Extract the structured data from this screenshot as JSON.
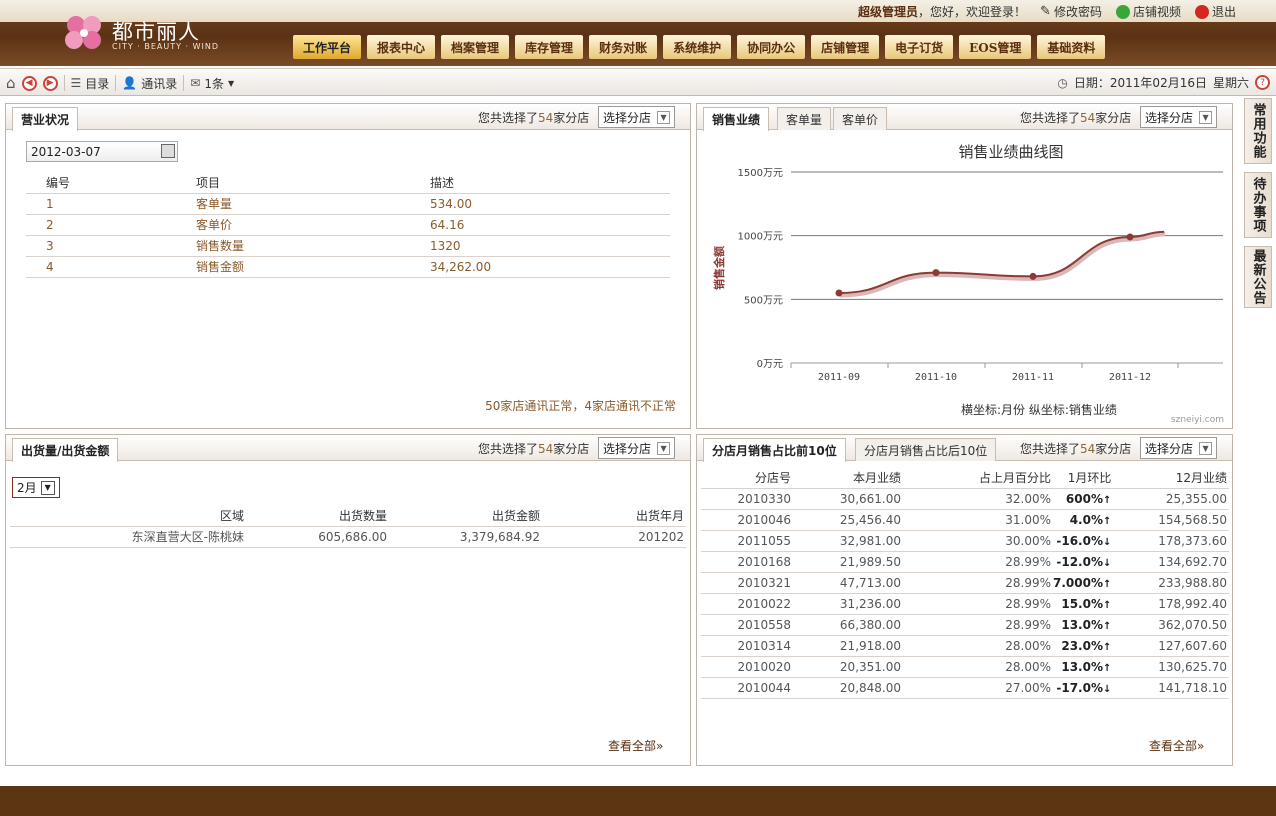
{
  "header": {
    "logo_cn": "都市丽人",
    "logo_en": "CITY · BEAUTY · WIND",
    "user_role": "超级管理员",
    "greeting": "，您好，欢迎登录！",
    "change_password": "修改密码",
    "store_video": "店铺视频",
    "logout": "退出",
    "nav": [
      "工作平台",
      "报表中心",
      "档案管理",
      "库存管理",
      "财务对账",
      "系统维护",
      "协同办公",
      "店铺管理",
      "电子订货",
      "EOS管理",
      "基础资料"
    ]
  },
  "toolbar": {
    "catalog": "目录",
    "contacts": "通讯录",
    "messages": "1条",
    "date_label": "日期：",
    "date_value": "2011年02月16日",
    "weekday": "星期六"
  },
  "panel_business": {
    "tab": "营业状况",
    "selected_prefix": "您共选择了",
    "selected_count": "54",
    "selected_suffix": "家分店",
    "select_button": "选择分店",
    "date": "2012-03-07",
    "columns": [
      "编号",
      "项目",
      "描述"
    ],
    "rows": [
      [
        "1",
        "客单量",
        "534.00"
      ],
      [
        "2",
        "客单价",
        "64.16"
      ],
      [
        "3",
        "销售数量",
        "1320"
      ],
      [
        "4",
        "销售金额",
        "34,262.00"
      ]
    ],
    "note": "50家店通讯正常，4家店通讯不正常"
  },
  "panel_sales": {
    "tabs": [
      "销售业绩",
      "客单量",
      "客单价"
    ],
    "selected_prefix": "您共选择了",
    "selected_count": "54",
    "selected_suffix": "家分店",
    "select_button": "选择分店",
    "axis_caption": "横坐标:月份 纵坐标:销售业绩",
    "watermark": "szneiyi.com"
  },
  "chart_data": {
    "type": "line",
    "title": "销售业绩曲线图",
    "ylabel": "销售金额",
    "categories": [
      "2011-09",
      "2011-10",
      "2011-11",
      "2011-12"
    ],
    "values": [
      550,
      710,
      680,
      990
    ],
    "extension_end_value": 1030,
    "yticks": [
      "0万元",
      "500万元",
      "1000万元",
      "1500万元"
    ],
    "ylim": [
      0,
      1500
    ],
    "grid": true,
    "line_color": "#8b3a35"
  },
  "panel_shipment": {
    "tab": "出货量/出货金额",
    "selected_prefix": "您共选择了",
    "selected_count": "54",
    "selected_suffix": "家分店",
    "select_button": "选择分店",
    "month": "2月",
    "columns": [
      "区域",
      "出货数量",
      "出货金额",
      "出货年月"
    ],
    "rows": [
      [
        "东深直营大区-陈桃妹",
        "605,686.00",
        "3,379,684.92",
        "201202"
      ]
    ],
    "more": "查看全部»"
  },
  "panel_ranking": {
    "tabs": [
      "分店月销售占比前10位",
      "分店月销售占比后10位"
    ],
    "selected_prefix": "您共选择了",
    "selected_count": "54",
    "selected_suffix": "家分店",
    "select_button": "选择分店",
    "columns": [
      "分店号",
      "本月业绩",
      "占上月百分比",
      "1月环比",
      "12月业绩"
    ],
    "rows": [
      [
        "2010330",
        "30,661.00",
        "32.00%",
        "600%",
        "up",
        "25,355.00"
      ],
      [
        "2010046",
        "25,456.40",
        "31.00%",
        "4.0%",
        "up",
        "154,568.50"
      ],
      [
        "2011055",
        "32,981.00",
        "30.00%",
        "-16.0%",
        "down",
        "178,373.60"
      ],
      [
        "2010168",
        "21,989.50",
        "28.99%",
        "-12.0%",
        "down",
        "134,692.70"
      ],
      [
        "2010321",
        "47,713.00",
        "28.99%",
        "7.000%",
        "up",
        "233,988.80"
      ],
      [
        "2010022",
        "31,236.00",
        "28.99%",
        "15.0%",
        "up",
        "178,992.40"
      ],
      [
        "2010558",
        "66,380.00",
        "28.99%",
        "13.0%",
        "up",
        "362,070.50"
      ],
      [
        "2010314",
        "21,918.00",
        "28.00%",
        "23.0%",
        "up",
        "127,607.60"
      ],
      [
        "2010020",
        "20,351.00",
        "28.00%",
        "13.0%",
        "up",
        "130,625.70"
      ],
      [
        "2010044",
        "20,848.00",
        "27.00%",
        "-17.0%",
        "down",
        "141,718.10"
      ]
    ],
    "more": "查看全部»"
  },
  "side_tabs": [
    "常用功能",
    "待办事项",
    "最新公告"
  ]
}
